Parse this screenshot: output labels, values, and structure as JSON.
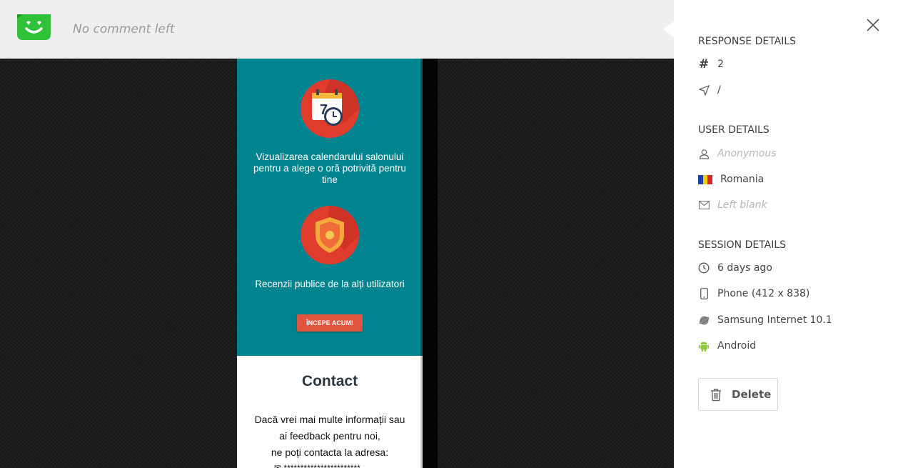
{
  "header": {
    "comment": "No comment left"
  },
  "preview": {
    "feature1": "Vizualizarea calendarului salonului pentru a alege o oră potrivită pentru tine",
    "feature2": "Recenzii publice de la alți utilizatori",
    "cta": "ÎNCEPE ACUM!",
    "contact_title": "Contact",
    "contact_line1": "Dacă vrei mai multe informații sau",
    "contact_line2": "ai feedback pentru noi,",
    "contact_line3": "ne poți contacta la adresa:",
    "contact_email": "***********************"
  },
  "response": {
    "title": "RESPONSE DETAILS",
    "number": "2",
    "page": "/"
  },
  "user": {
    "title": "USER DETAILS",
    "name": "Anonymous",
    "country": "Romania",
    "email": "Left blank"
  },
  "session": {
    "title": "SESSION DETAILS",
    "time": "6 days ago",
    "device": "Phone (412 x 838)",
    "browser": "Samsung Internet 10.1",
    "os": "Android"
  },
  "actions": {
    "delete": "Delete"
  },
  "colors": {
    "accent": "#2ecc40",
    "teal": "#008490",
    "cta": "#e0533c"
  }
}
